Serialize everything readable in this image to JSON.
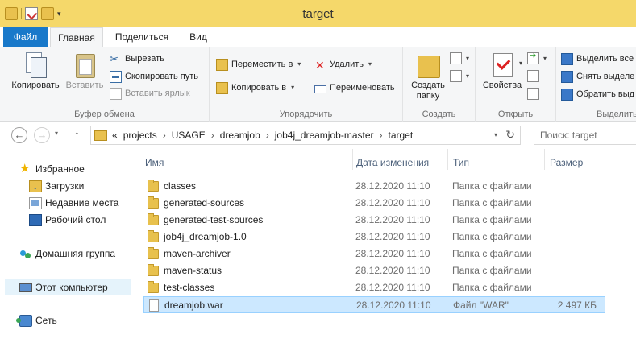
{
  "window": {
    "title": "target"
  },
  "ribbon": {
    "tabs": [
      {
        "label": "Файл"
      },
      {
        "label": "Главная"
      },
      {
        "label": "Поделиться"
      },
      {
        "label": "Вид"
      }
    ],
    "clipboard": {
      "label": "Буфер обмена",
      "copy": "Копировать",
      "paste": "Вставить",
      "cut": "Вырезать",
      "copy_path": "Скопировать путь",
      "paste_shortcut": "Вставить ярлык"
    },
    "organize": {
      "label": "Упорядочить",
      "move_to": "Переместить в",
      "copy_to": "Копировать в",
      "delete": "Удалить",
      "rename": "Переименовать"
    },
    "create": {
      "label": "Создать",
      "new_folder_line1": "Создать",
      "new_folder_line2": "папку"
    },
    "open": {
      "label": "Открыть",
      "properties": "Свойства"
    },
    "select": {
      "label": "Выделить",
      "select_all": "Выделить все",
      "select_none": "Снять выделе",
      "invert": "Обратить выд"
    }
  },
  "address": {
    "prefix": "«",
    "crumbs": [
      "projects",
      "USAGE",
      "dreamjob",
      "job4j_dreamjob-master",
      "target"
    ]
  },
  "search": {
    "placeholder": "Поиск: target"
  },
  "nav": {
    "favorites": "Избранное",
    "downloads": "Загрузки",
    "recent": "Недавние места",
    "desktop": "Рабочий стол",
    "homegroup": "Домашняя группа",
    "computer": "Этот компьютер",
    "network": "Сеть"
  },
  "columns": {
    "name": "Имя",
    "date": "Дата изменения",
    "type": "Тип",
    "size": "Размер"
  },
  "files": [
    {
      "name": "classes",
      "date": "28.12.2020 11:10",
      "type": "Папка с файлами",
      "size": "",
      "kind": "folder"
    },
    {
      "name": "generated-sources",
      "date": "28.12.2020 11:10",
      "type": "Папка с файлами",
      "size": "",
      "kind": "folder"
    },
    {
      "name": "generated-test-sources",
      "date": "28.12.2020 11:10",
      "type": "Папка с файлами",
      "size": "",
      "kind": "folder"
    },
    {
      "name": "job4j_dreamjob-1.0",
      "date": "28.12.2020 11:10",
      "type": "Папка с файлами",
      "size": "",
      "kind": "folder"
    },
    {
      "name": "maven-archiver",
      "date": "28.12.2020 11:10",
      "type": "Папка с файлами",
      "size": "",
      "kind": "folder"
    },
    {
      "name": "maven-status",
      "date": "28.12.2020 11:10",
      "type": "Папка с файлами",
      "size": "",
      "kind": "folder"
    },
    {
      "name": "test-classes",
      "date": "28.12.2020 11:10",
      "type": "Папка с файлами",
      "size": "",
      "kind": "folder"
    },
    {
      "name": "dreamjob.war",
      "date": "28.12.2020 11:10",
      "type": "Файл \"WAR\"",
      "size": "2 497 КБ",
      "kind": "file"
    }
  ]
}
